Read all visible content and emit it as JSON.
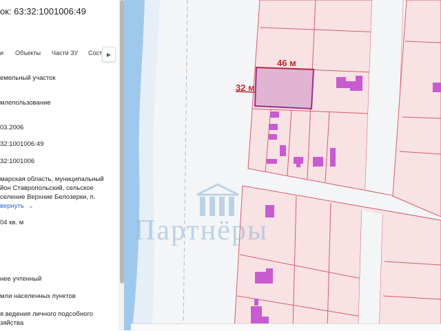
{
  "header": {
    "title": "ок: 63:32:1001006:49"
  },
  "tabs": [
    {
      "label": "и"
    },
    {
      "label": "Объекты"
    },
    {
      "label": "Части ЗУ"
    },
    {
      "label": "Соста"
    }
  ],
  "tab_more_icon": "chevron-right-icon",
  "fields": [
    {
      "value": "емельный участок"
    },
    {
      "value": "млепользование"
    },
    {
      "value": "03.2006"
    },
    {
      "value": "32:1001006:49"
    },
    {
      "value": "32:1001006"
    },
    {
      "value": "марская область, муниципальный"
    },
    {
      "value": "йон Ставропольский, сельское"
    },
    {
      "value": "селение Верхние Белозерки, п."
    },
    {
      "value": "04 кв. м"
    },
    {
      "value": "нее учтенный"
    },
    {
      "value": "мли населенных пунктов"
    },
    {
      "value": "я ведения личного подсобного"
    },
    {
      "value": "зяйства"
    }
  ],
  "collapse_link": "вернуть",
  "map": {
    "dim_width": "46 м",
    "dim_height": "32 м",
    "watermark": "Партнёры",
    "colors": {
      "parcel_fill": "#f8e2e4",
      "parcel_stroke": "#d65c6a",
      "selected_fill": "#e0b4d2",
      "selected_stroke": "#9b2c8c",
      "building": "#c95bd0",
      "water": "#9fc9ec",
      "dim_label": "#c0282d"
    }
  }
}
